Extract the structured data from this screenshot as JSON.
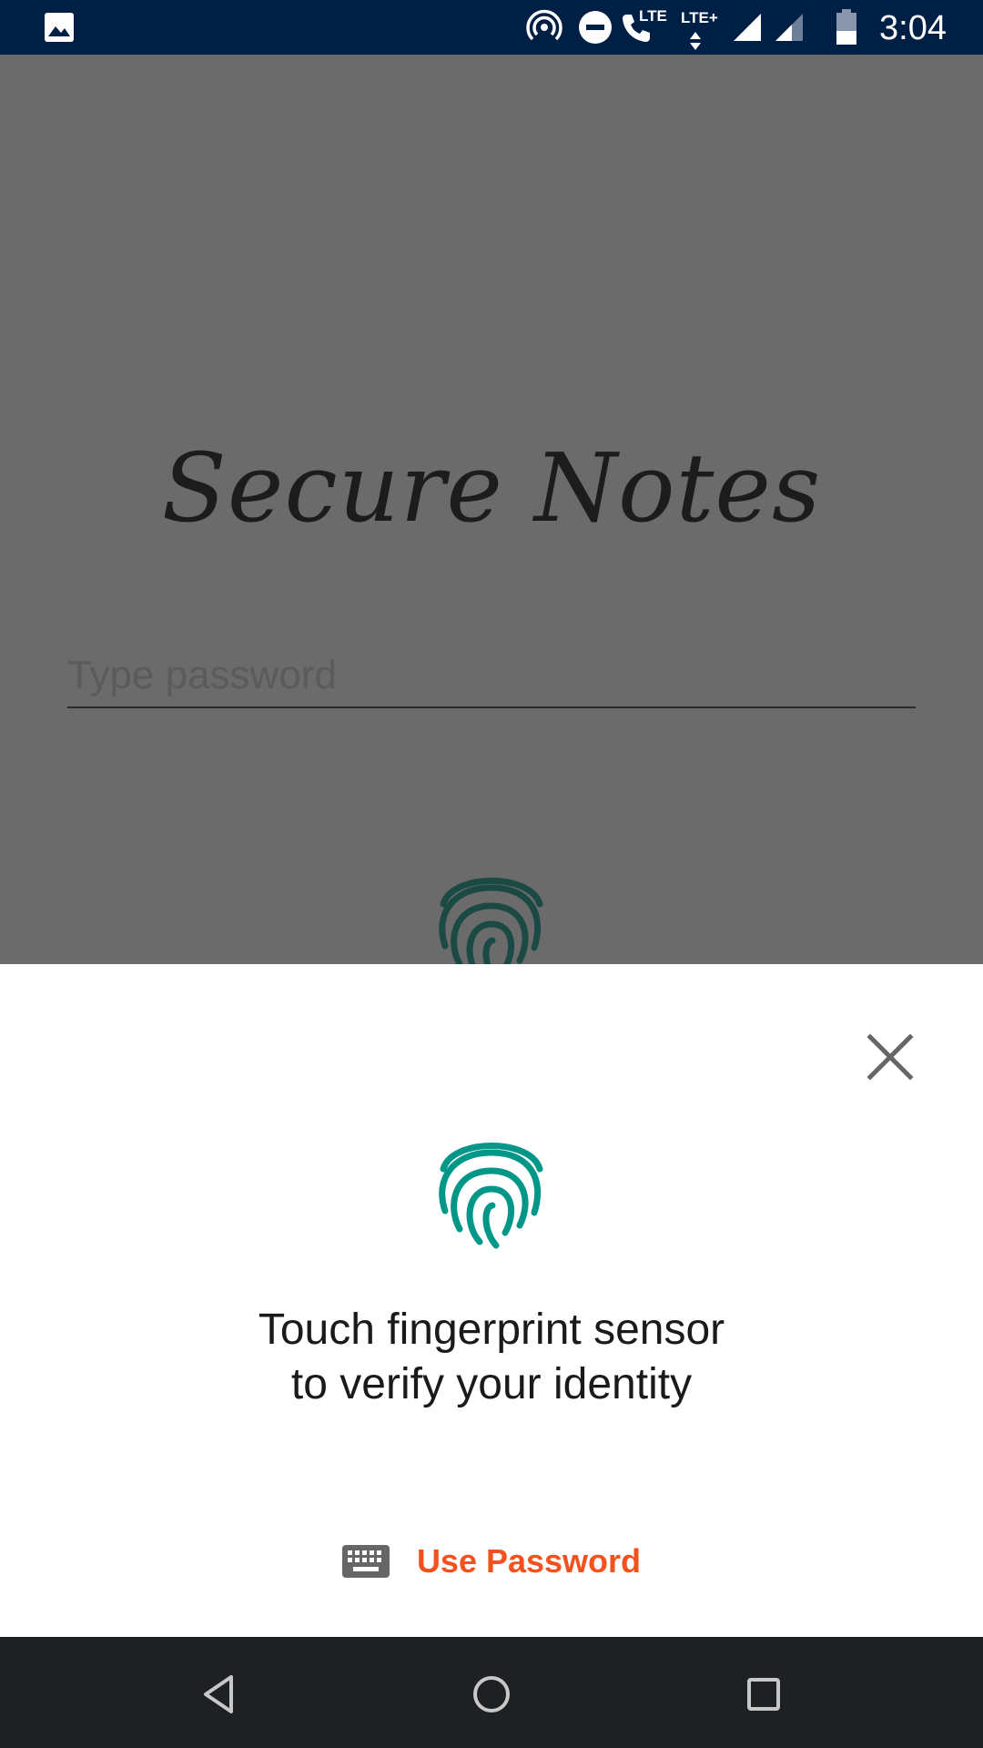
{
  "status_bar": {
    "time": "3:04",
    "network_label": "LTE+",
    "call_label": "LTE",
    "icons": [
      "image-icon",
      "hotspot-icon",
      "dnd-icon",
      "volte-call-icon",
      "lte-plus-data-icon",
      "signal-full-icon",
      "signal-partial-icon",
      "battery-icon"
    ]
  },
  "app": {
    "title": "Secure Notes",
    "password_placeholder": "Type password"
  },
  "dialog": {
    "prompt_line1": "Touch fingerprint sensor",
    "prompt_line2": "to verify your identity",
    "use_password_label": "Use Password",
    "accent_color": "#009688",
    "link_color": "#f4511e"
  },
  "nav_bar": {
    "buttons": [
      "back-icon",
      "home-icon",
      "recents-icon"
    ]
  }
}
